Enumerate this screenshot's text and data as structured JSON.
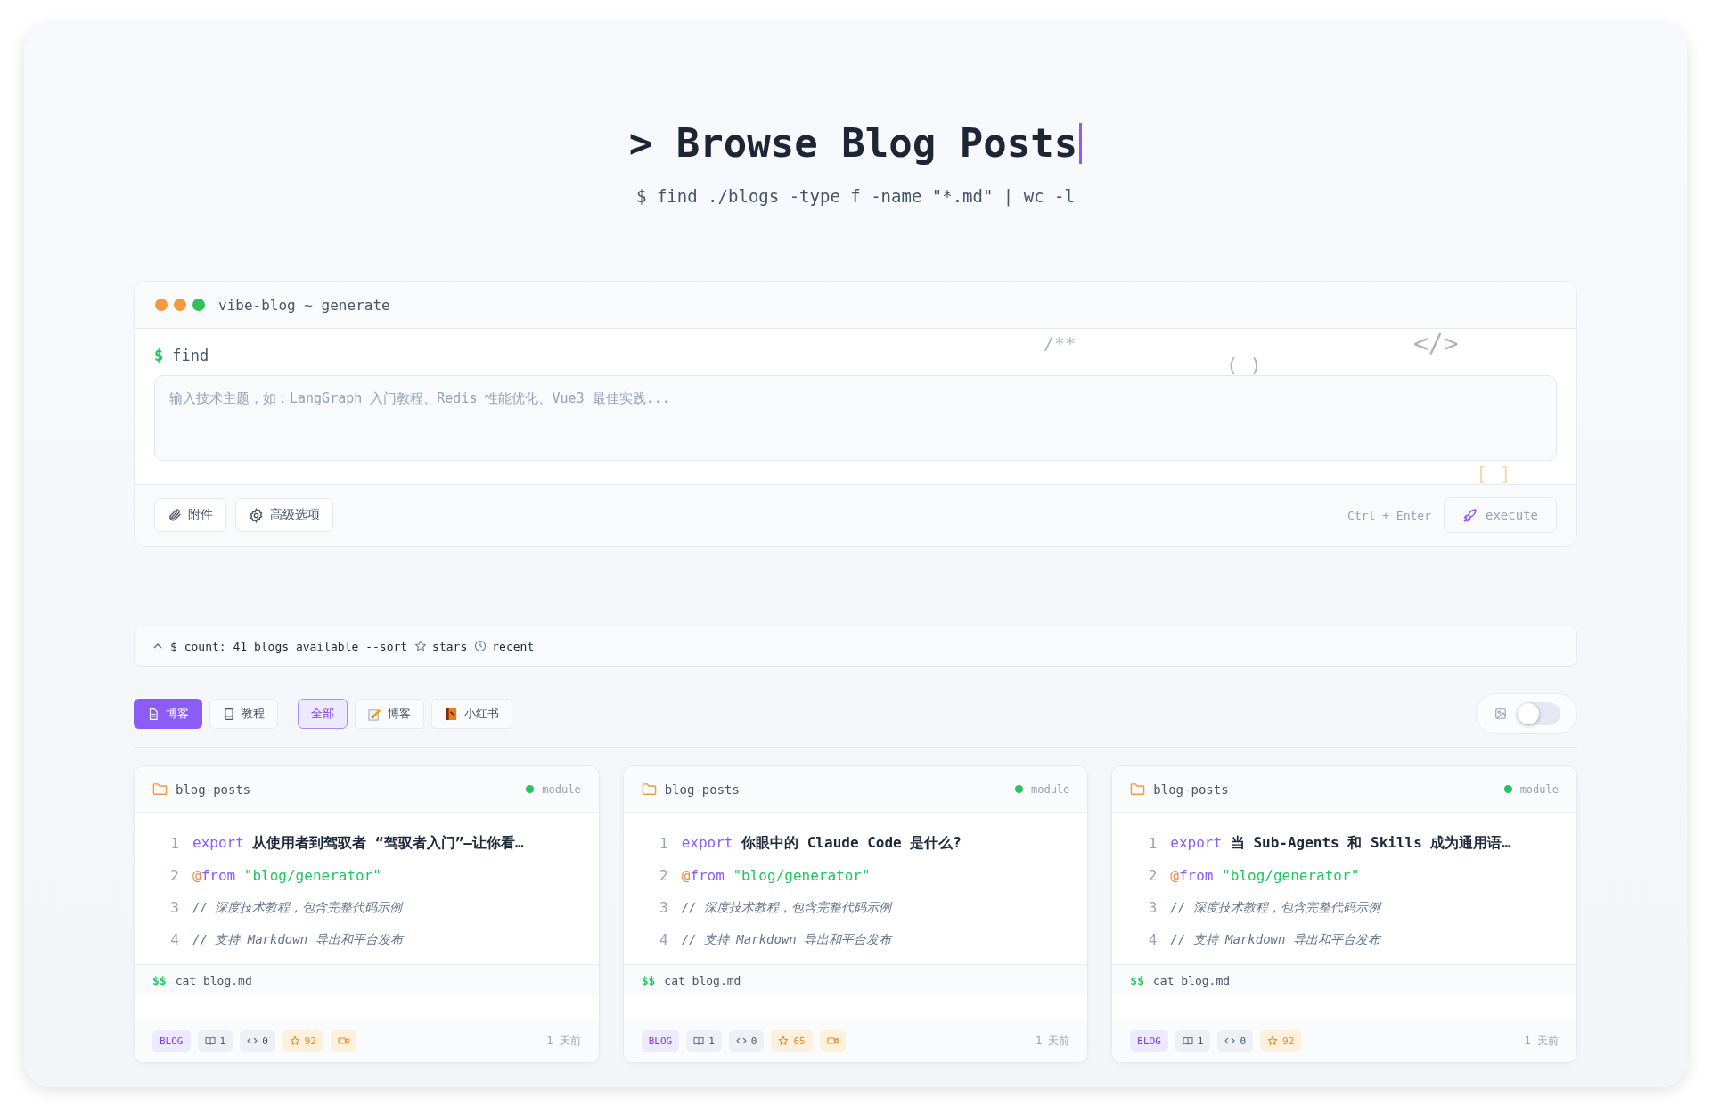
{
  "header": {
    "prompt": ">",
    "title": "Browse Blog Posts",
    "subtitle": "$ find ./blogs -type f -name \"*.md\" | wc -l"
  },
  "terminal": {
    "title": "vibe-blog ~ generate",
    "prompt_symbol": "$",
    "command": "find",
    "input": {
      "placeholder": "输入技术主题，如：LangGraph 入门教程、Redis 性能优化、Vue3 最佳实践..."
    },
    "decorations": [
      "/**",
      "( )",
      "</>",
      "[ ]"
    ],
    "buttons": [
      {
        "kind": "attach",
        "label": "附件"
      },
      {
        "kind": "settings",
        "label": "高级选项"
      }
    ],
    "shortcut": "Ctrl + Enter",
    "execute": {
      "label": "execute",
      "disabled": true
    }
  },
  "count_bar": {
    "expanded": true,
    "text": "$ count: 41 blogs available --sort",
    "sort_options": [
      {
        "kind": "stars",
        "label": "stars"
      },
      {
        "kind": "recent",
        "label": "recent"
      }
    ]
  },
  "type_tabs": [
    {
      "kind": "doc",
      "label": "博客",
      "selected": true
    },
    {
      "kind": "book",
      "label": "教程",
      "selected": false
    }
  ],
  "categories": [
    {
      "kind": "all",
      "label": "全部",
      "selected": true
    },
    {
      "kind": "memo",
      "label": "博客",
      "selected": false
    },
    {
      "kind": "notebook",
      "label": "小红书",
      "selected": false
    }
  ],
  "image_toggle": {
    "on": false
  },
  "cards": [
    {
      "folder": "blog-posts",
      "status": {
        "label": "module",
        "color": "#22c55e"
      },
      "lines": [
        {
          "number": "1",
          "tokens": [
            {
              "kind": "keyword",
              "text": "export"
            },
            {
              "kind": "title",
              "text": "从使用者到驾驭者 “驾驭者入门”—让你看…"
            }
          ]
        },
        {
          "number": "2",
          "tokens": [
            {
              "kind": "at",
              "text": "@"
            },
            {
              "kind": "keyword",
              "text": "from"
            },
            {
              "kind": "string",
              "text": "\"blog/generator\""
            }
          ]
        },
        {
          "number": "3",
          "tokens": [
            {
              "kind": "comment",
              "text": "// 深度技术教程，包含完整代码示例"
            }
          ]
        },
        {
          "number": "4",
          "tokens": [
            {
              "kind": "comment",
              "text": "// 支持 Markdown 导出和平台发布"
            }
          ]
        }
      ],
      "prompt": "$$",
      "command": "cat blog.md",
      "badges": [
        {
          "kind": "type",
          "text": "BLOG"
        },
        {
          "kind": "book",
          "text": "1"
        },
        {
          "kind": "code",
          "text": "0"
        },
        {
          "kind": "stars",
          "text": "92"
        },
        {
          "kind": "video"
        }
      ],
      "time": "1 天前"
    },
    {
      "folder": "blog-posts",
      "status": {
        "label": "module",
        "color": "#22c55e"
      },
      "lines": [
        {
          "number": "1",
          "tokens": [
            {
              "kind": "keyword",
              "text": "export"
            },
            {
              "kind": "title",
              "text": "你眼中的 Claude Code 是什么?"
            }
          ]
        },
        {
          "number": "2",
          "tokens": [
            {
              "kind": "at",
              "text": "@"
            },
            {
              "kind": "keyword",
              "text": "from"
            },
            {
              "kind": "string",
              "text": "\"blog/generator\""
            }
          ]
        },
        {
          "number": "3",
          "tokens": [
            {
              "kind": "comment",
              "text": "// 深度技术教程，包含完整代码示例"
            }
          ]
        },
        {
          "number": "4",
          "tokens": [
            {
              "kind": "comment",
              "text": "// 支持 Markdown 导出和平台发布"
            }
          ]
        }
      ],
      "prompt": "$$",
      "command": "cat blog.md",
      "badges": [
        {
          "kind": "type",
          "text": "BLOG"
        },
        {
          "kind": "book",
          "text": "1"
        },
        {
          "kind": "code",
          "text": "0"
        },
        {
          "kind": "stars",
          "text": "65"
        },
        {
          "kind": "video"
        }
      ],
      "time": "1 天前"
    },
    {
      "folder": "blog-posts",
      "status": {
        "label": "module",
        "color": "#22c55e"
      },
      "lines": [
        {
          "number": "1",
          "tokens": [
            {
              "kind": "keyword",
              "text": "export"
            },
            {
              "kind": "title",
              "text": "当 Sub-Agents 和 Skills 成为通用语…"
            }
          ]
        },
        {
          "number": "2",
          "tokens": [
            {
              "kind": "at",
              "text": "@"
            },
            {
              "kind": "keyword",
              "text": "from"
            },
            {
              "kind": "string",
              "text": "\"blog/generator\""
            }
          ]
        },
        {
          "number": "3",
          "tokens": [
            {
              "kind": "comment",
              "text": "// 深度技术教程，包含完整代码示例"
            }
          ]
        },
        {
          "number": "4",
          "tokens": [
            {
              "kind": "comment",
              "text": "// 支持 Markdown 导出和平台发布"
            }
          ]
        }
      ],
      "prompt": "$$",
      "command": "cat blog.md",
      "badges": [
        {
          "kind": "type",
          "text": "BLOG"
        },
        {
          "kind": "book",
          "text": "1"
        },
        {
          "kind": "code",
          "text": "0"
        },
        {
          "kind": "stars",
          "text": "92"
        }
      ],
      "time": "1 天前"
    }
  ]
}
